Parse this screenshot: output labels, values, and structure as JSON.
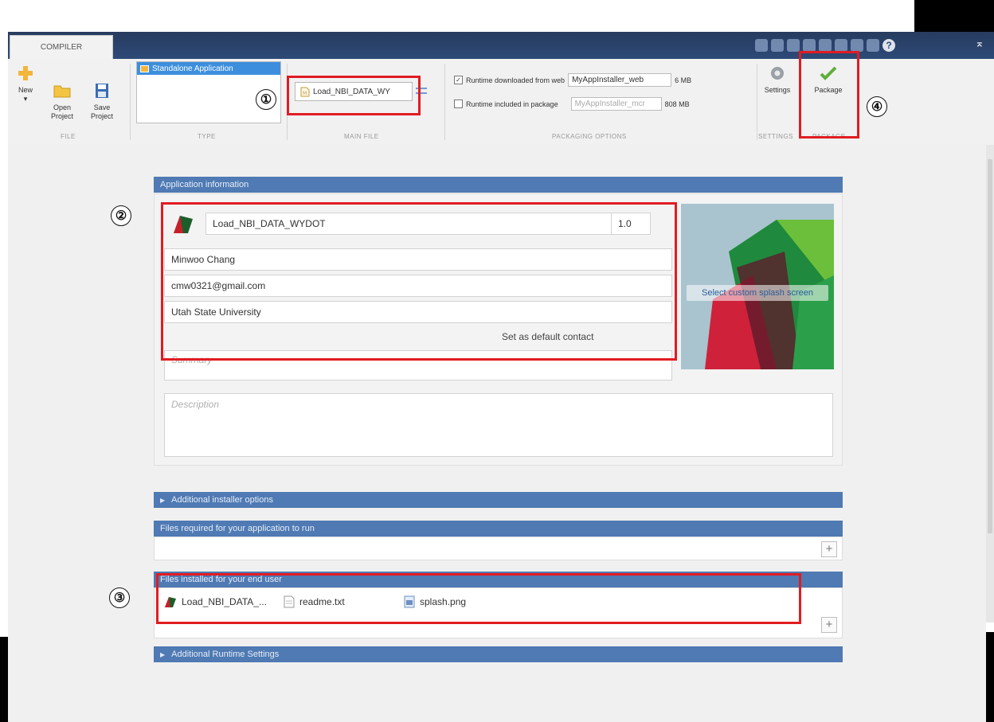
{
  "ribbon": {
    "tab_label": "COMPILER",
    "file_group": {
      "label": "FILE",
      "new_label": "New",
      "new_dropdown": "▾",
      "open_label": "Open\nProject",
      "save_label": "Save\nProject"
    },
    "type_group": {
      "label": "TYPE",
      "selected_item": "Standalone Application"
    },
    "main_file_group": {
      "label": "MAIN FILE",
      "file_name": "Load_NBI_DATA_WY"
    },
    "packaging_group": {
      "label": "PACKAGING OPTIONS",
      "web_label": "Runtime downloaded from web",
      "web_checked": true,
      "web_field": "MyAppInstaller_web",
      "web_size": "6 MB",
      "pkg_label": "Runtime included in package",
      "pkg_checked": false,
      "pkg_field": "MyAppInstaller_mcr",
      "pkg_size": "808 MB"
    },
    "settings_group": {
      "label": "SETTINGS",
      "button_label": "Settings"
    },
    "package_group": {
      "label": "PACKAGE",
      "button_label": "Package"
    }
  },
  "app_info": {
    "header": "Application information",
    "app_name": "Load_NBI_DATA_WYDOT",
    "version": "1.0",
    "author": "Minwoo Chang",
    "email": "cmw0321@gmail.com",
    "company": "Utah State University",
    "set_default_contact": "Set as default contact",
    "summary_placeholder": "Summary",
    "description_placeholder": "Description",
    "splash_label": "Select custom splash screen"
  },
  "sections": {
    "additional_installer": "Additional installer options",
    "files_required": "Files required for your application to run",
    "files_installed": "Files installed for your end user",
    "additional_runtime": "Additional Runtime Settings"
  },
  "installed_files": [
    {
      "name": "Load_NBI_DATA_...",
      "icon": "matlab-app-icon"
    },
    {
      "name": "readme.txt",
      "icon": "text-file-icon"
    },
    {
      "name": "splash.png",
      "icon": "image-file-icon"
    }
  ],
  "annotations": {
    "one": "①",
    "two": "②",
    "three": "③",
    "four": "④"
  },
  "colors": {
    "section_header": "#4f7ab3",
    "annotation_red": "#e11c22",
    "selection_blue": "#3d8fde"
  }
}
